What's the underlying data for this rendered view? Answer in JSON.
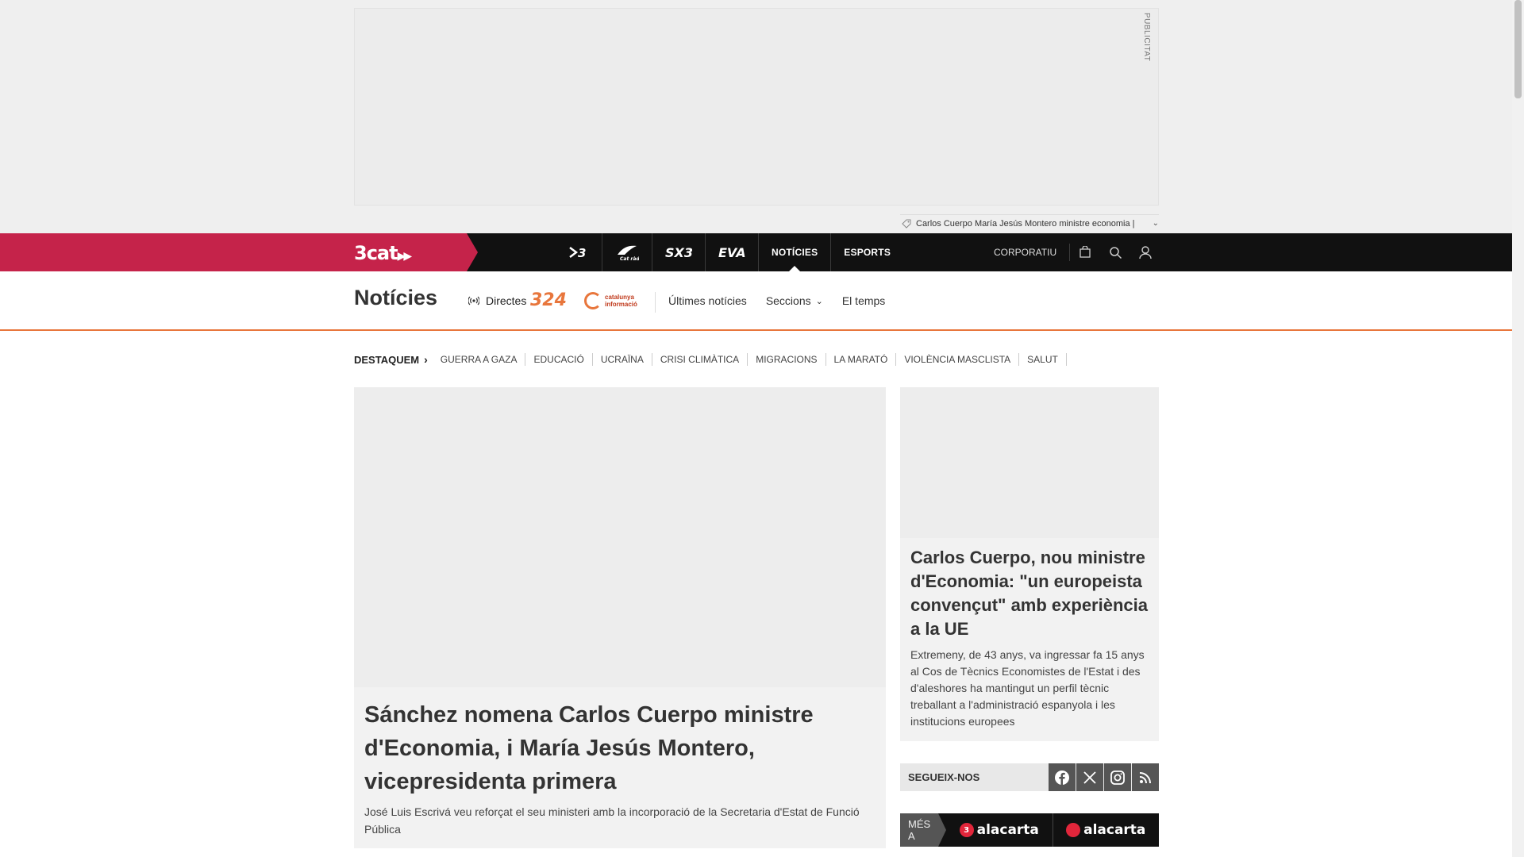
{
  "ad": {
    "label": "PUBLICITAT",
    "ticker_text": "Carlos Cuerpo María Jesús Montero ministre economia |"
  },
  "topbar": {
    "logo": "3cat",
    "channels": [
      {
        "label": "3",
        "icon": "tv3-logo-icon"
      },
      {
        "label": "Cat ràdio",
        "icon": "catradio-logo-icon"
      },
      {
        "label": "SX3",
        "icon": "sx3-logo-icon"
      },
      {
        "label": "EVA",
        "icon": "eva-logo-icon"
      },
      {
        "label": "NOTÍCIES"
      },
      {
        "label": "ESPORTS"
      }
    ],
    "corporate": "CORPORATIU"
  },
  "section": {
    "title": "Notícies",
    "directes": "Directes",
    "logo_324": "324",
    "logo_ci_line1": "catalunya",
    "logo_ci_line2": "informació",
    "links": [
      "Últimes notícies",
      "Seccions",
      "El temps"
    ]
  },
  "highlights": {
    "label": "DESTAQUEM",
    "topics": [
      "GUERRA A GAZA",
      "EDUCACIÓ",
      "UCRAÏNA",
      "CRISI CLIMÀTICA",
      "MIGRACIONS",
      "LA MARATÓ",
      "VIOLÈNCIA MASCLISTA",
      "SALUT"
    ]
  },
  "main_story": {
    "headline": "Sánchez nomena Carlos Cuerpo ministre d'Economia, i María Jesús Montero, vicepresidenta primera",
    "summary": "José Luis Escrivá veu reforçat el seu ministeri amb la incorporació de la Secretaria d'Estat de Funció Pública"
  },
  "side_story": {
    "headline": "Carlos Cuerpo, nou ministre d'Economia: \"un europeista convençut\" amb experiència a la UE",
    "summary": "Extremeny, de 43 anys, va ingressar fa 15 anys al Cos de Tècnics Economistes de l'Estat i des d'aleshores ha mantingut un perfil tècnic treballant a l'administració espanyola i les institucions europees"
  },
  "follow": {
    "label": "SEGUEIX-NOS",
    "networks": [
      "facebook-icon",
      "x-icon",
      "instagram-icon",
      "rss-icon"
    ]
  },
  "mes_a": {
    "label": "MÉS A",
    "brands": [
      "alacarta",
      "alacarta"
    ],
    "badges": [
      "3",
      ""
    ]
  }
}
